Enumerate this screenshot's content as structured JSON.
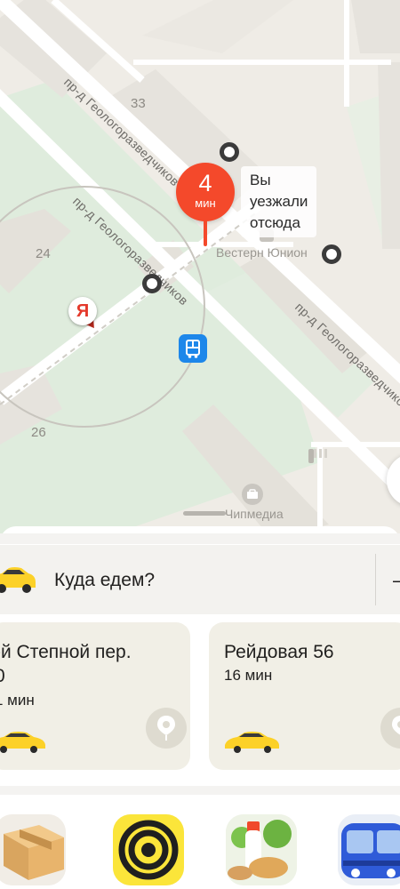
{
  "map": {
    "building_numbers": [
      "33",
      "24",
      "26"
    ],
    "streets": [
      "пр-д Геологоразведчиков",
      "пр-д Геологоразведчиков",
      "пр-д Геологоразведчиков"
    ],
    "poi_western_union": "Вестерн Юнион",
    "poi_chipmedia": "Чипмедиа",
    "eta_pin": {
      "value": "4",
      "unit": "мин"
    },
    "was_here_line1": "Вы",
    "was_here_line2": "уезжали",
    "was_here_line3": "отсюда",
    "ya_marker_letter": "Я",
    "colors": {
      "background": "#efece6",
      "green_zone": "#dfecdd",
      "road": "#ffffff",
      "eta_accent": "#f4492b",
      "bus_stop": "#1d87ea"
    }
  },
  "where_row": {
    "label": "Куда едем?",
    "extra": "—"
  },
  "destinations": [
    {
      "title_line1": "-й Степной пер.",
      "title_line2": "0",
      "time": "1 мин"
    },
    {
      "title_line1": "Рейдовая 56",
      "title_line2": "",
      "time": "16 мин"
    }
  ],
  "services": [
    {
      "icon": "delivery-box-icon"
    },
    {
      "icon": "spiral-icon"
    },
    {
      "icon": "groceries-icon"
    },
    {
      "icon": "bus-icon"
    }
  ]
}
